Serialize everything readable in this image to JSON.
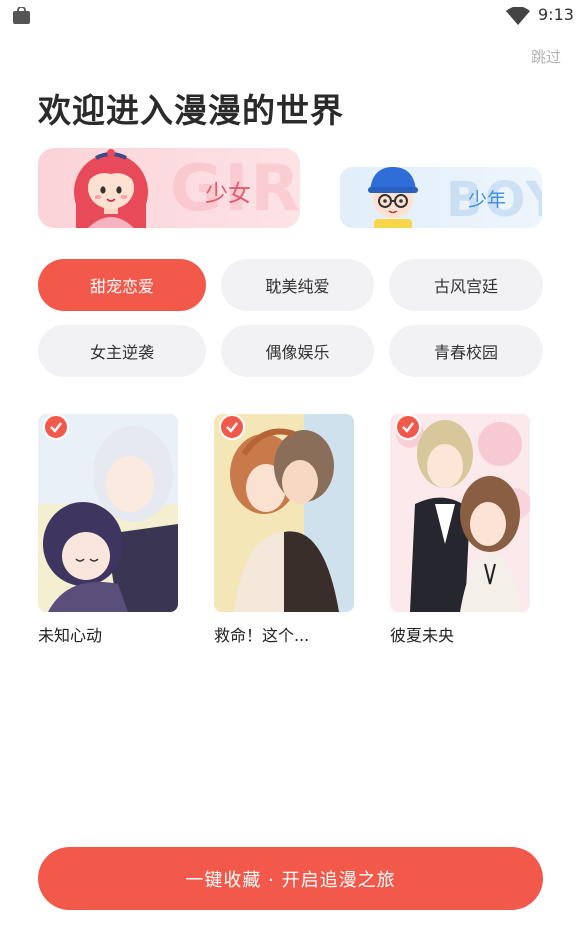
{
  "status_bar": {
    "time": "9:13",
    "icons": [
      "shopping-bag-icon",
      "wifi-icon"
    ]
  },
  "header": {
    "skip_label": "跳过",
    "title": "欢迎进入漫漫的世界"
  },
  "gender": {
    "options": [
      {
        "label": "少女",
        "bg_text": "GIRL",
        "selected": true
      },
      {
        "label": "少年",
        "bg_text": "BOY",
        "selected": false
      }
    ]
  },
  "tags": [
    {
      "label": "甜宠恋爱",
      "selected": true
    },
    {
      "label": "耽美纯爱",
      "selected": false
    },
    {
      "label": "古风宫廷",
      "selected": false
    },
    {
      "label": "女主逆袭",
      "selected": false
    },
    {
      "label": "偶像娱乐",
      "selected": false
    },
    {
      "label": "青春校园",
      "selected": false
    }
  ],
  "books": [
    {
      "title": "未知心动",
      "checked": true
    },
    {
      "title": "救命！这个...",
      "checked": true
    },
    {
      "title": "彼夏未央",
      "checked": true
    }
  ],
  "cta": {
    "label": "一键收藏 · 开启追漫之旅"
  },
  "colors": {
    "accent": "#f2594b",
    "tag_bg": "#f2f2f4",
    "girl_card": "#fbd3d8",
    "boy_card": "#e2eefa"
  }
}
